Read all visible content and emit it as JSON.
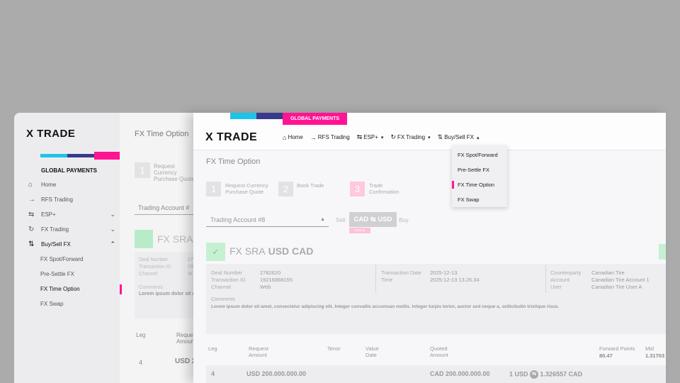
{
  "brand": {
    "logo": "X TRADE",
    "tagline": "GLOBAL PAYMENTS",
    "accent": "#ff1493",
    "cyan": "#1ec3e8",
    "navy": "#3a3a8c"
  },
  "back_window": {
    "sidebar": {
      "items": [
        {
          "label": "Home"
        },
        {
          "label": "RFS Trading"
        },
        {
          "label": "ESP+"
        },
        {
          "label": "FX Trading"
        },
        {
          "label": "Buy/Sell FX"
        }
      ],
      "subitems": [
        {
          "label": "FX Spot/Forward"
        },
        {
          "label": "Pre-Settle FX"
        },
        {
          "label": "FX Time Option"
        },
        {
          "label": "FX Swap"
        }
      ]
    },
    "title": "FX Time Option",
    "step1_label": "Request Currency Purchase Quote",
    "step1_num": "1",
    "account_placeholder": "Trading Account #",
    "fxsra": "FX SRA",
    "deal_labels": [
      "Deal Number",
      "Transaction ID",
      "Channel"
    ],
    "deal_values": [
      "27",
      "19",
      "W"
    ],
    "comments_label": "Comments",
    "lorem": "Lorem ipsum dolor sit amet",
    "col_leg": "Leg",
    "col_req": "Request Amount",
    "row_leg": "4",
    "row_amount": "USD 20"
  },
  "header": {
    "nav": [
      {
        "label": "Home",
        "icon": "home-icon"
      },
      {
        "label": "RFS Trading",
        "icon": "arrow-right-icon"
      },
      {
        "label": "ESP+",
        "icon": "swap-icon"
      },
      {
        "label": "FX Trading",
        "icon": "refresh-icon"
      },
      {
        "label": "Buy/Sell FX",
        "icon": "buy-sell-icon"
      }
    ],
    "dropdown": [
      {
        "label": "FX Spot/Forward"
      },
      {
        "label": "Pre-Settle FX"
      },
      {
        "label": "FX Time Option"
      },
      {
        "label": "FX Swap"
      }
    ]
  },
  "page": {
    "title": "FX Time Option",
    "steps": [
      {
        "num": "1",
        "label": "Request Currency Purchase Quote"
      },
      {
        "num": "2",
        "label": "Book Trade"
      },
      {
        "num": "3",
        "label": "Trade Confirmation"
      }
    ],
    "account": "Trading Account #8",
    "sell_label": "Sell",
    "buy_label": "Buy",
    "pair_from": "CAD",
    "pair_to": "USD",
    "badge": "Natural",
    "product": "FX SRA",
    "pair_display": "USD CAD",
    "details": {
      "deal_number_label": "Deal Number",
      "deal_number": "2782620",
      "transaction_id_label": "Transaction ID",
      "transaction_id": "19216868155",
      "channel_label": "Channel",
      "channel": "Web",
      "transaction_date_label": "Transaction Date",
      "transaction_date": "2025-12-13",
      "time_label": "Time",
      "time": "2025-12-13 13.26.34",
      "counterparty_label": "Counterparty",
      "counterparty": "Canadian Tire",
      "account_label": "Account",
      "account": "Canadian Tire Account 1",
      "user_label": "User",
      "user": "Canadian Tire User A"
    },
    "comments_label": "Comments",
    "comments": "Lorem ipsum dolor sit amet, consectetur adipiscing elit. Integer convallis accumsan mollis. Integer turpis tortor, auctor sed neque a, sollicitudin tristique risus.",
    "table": {
      "headers": [
        "Leg",
        "Request Amount",
        "Tenor",
        "Value Date",
        "Quoted Amount",
        "Forward Points",
        "Mid"
      ],
      "forward_points": "80.47",
      "mid": "1.31703",
      "row": {
        "leg": "4",
        "request_amount": "USD 200.000.000.00",
        "quoted_amount": "CAD 200.000.000.00",
        "rate_left": "1 USD",
        "rate_right": "1.326557 CAD"
      }
    }
  }
}
